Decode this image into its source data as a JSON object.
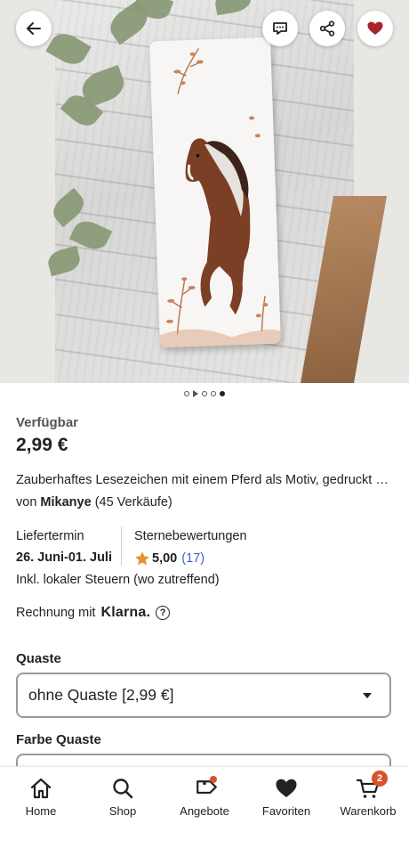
{
  "header": {
    "back_icon": "arrow-left-icon",
    "message_icon": "message-icon",
    "share_icon": "share-icon",
    "favorite_icon": "heart-icon"
  },
  "gallery": {
    "total_images": 5,
    "active_index": 4
  },
  "product": {
    "availability": "Verfügbar",
    "price": "2,99 €",
    "title": "Zauberhaftes Lesezeichen mit einem Pferd als Motiv, gedruckt …",
    "seller_prefix": "von",
    "seller_name": "Mikanye",
    "seller_sales": "(45 Verkäufe)"
  },
  "delivery": {
    "label": "Liefertermin",
    "value": "26. Juni-01. Juli"
  },
  "rating": {
    "label": "Sternebewertungen",
    "value": "5,00",
    "count": "(17)"
  },
  "tax_note": "Inkl. lokaler Steuern (wo zutreffend)",
  "klarna": {
    "prefix": "Rechnung mit",
    "brand": "Klarna."
  },
  "options": [
    {
      "label": "Quaste",
      "selected": "ohne Quaste [2,99 €]"
    },
    {
      "label": "Farbe Quaste",
      "selected": ""
    }
  ],
  "nav": [
    {
      "label": "Home",
      "icon": "home-icon"
    },
    {
      "label": "Shop",
      "icon": "search-icon"
    },
    {
      "label": "Angebote",
      "icon": "tag-icon"
    },
    {
      "label": "Favoriten",
      "icon": "heart-icon"
    },
    {
      "label": "Warenkorb",
      "icon": "cart-icon",
      "badge": "2"
    }
  ],
  "colors": {
    "accent": "#d9522b",
    "heart": "#a8232b",
    "star": "#e3932b",
    "link": "#3b5fc4"
  }
}
